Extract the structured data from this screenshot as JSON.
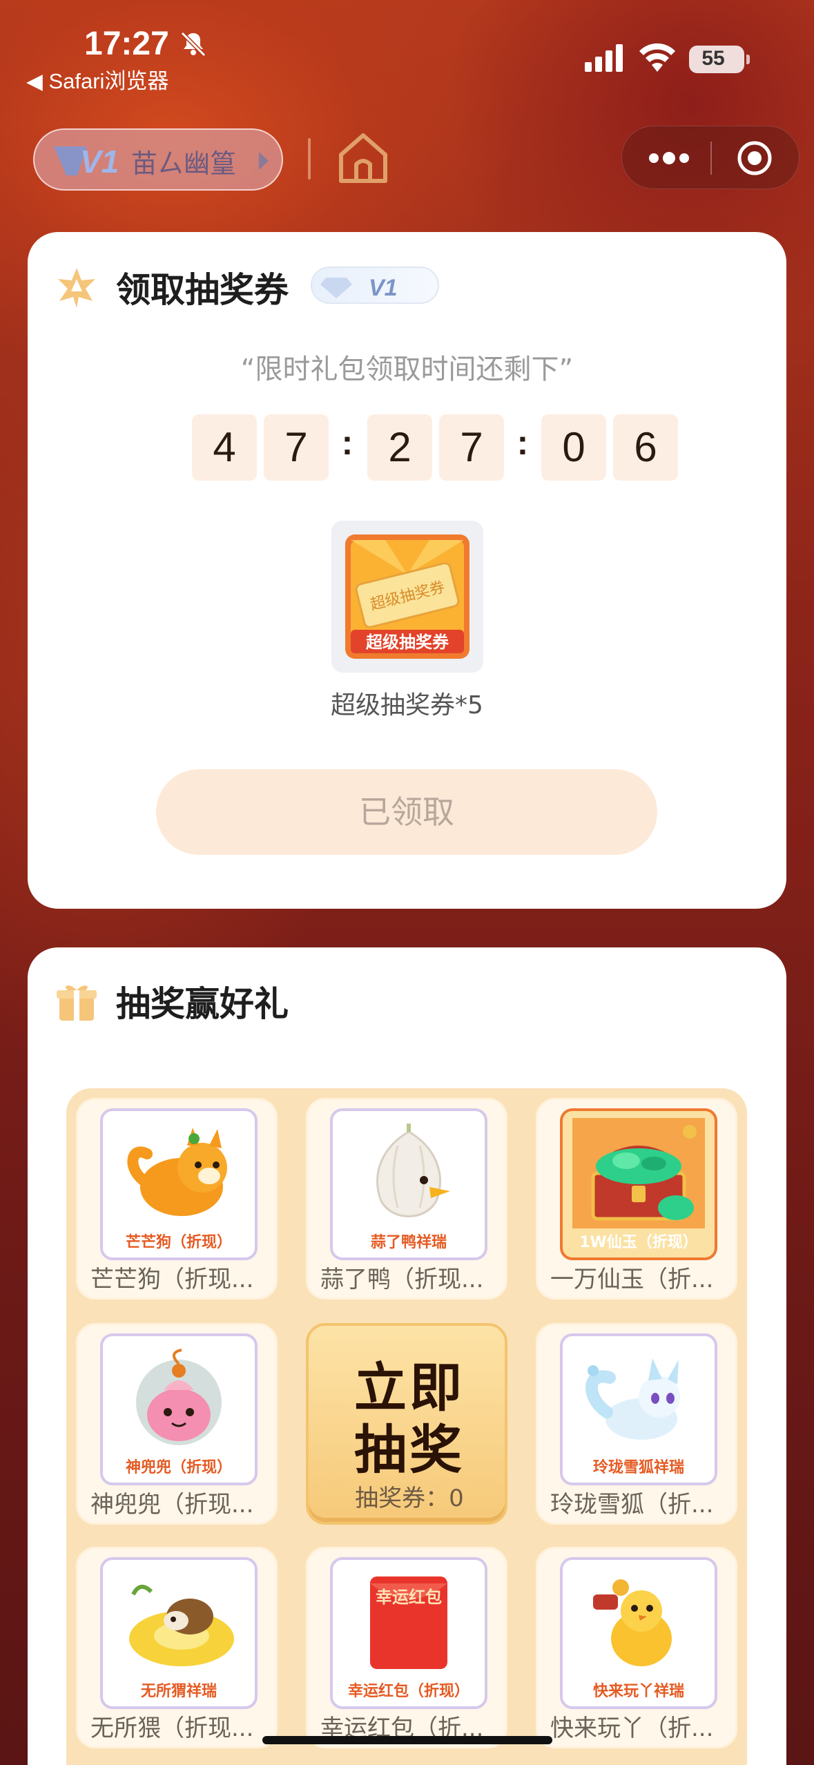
{
  "status_bar": {
    "time": "17:27",
    "back_app": "◀ Safari浏览器",
    "battery": "55"
  },
  "nav": {
    "vip_level": "V1",
    "username": "苗ㄙ幽篁",
    "menu_icon": "more-dots-icon",
    "close_icon": "target-icon"
  },
  "claim_card": {
    "title": "领取抽奖券",
    "badge": "V1",
    "subtitle": "“限时礼包领取时间还剩下”",
    "countdown": {
      "h1": "4",
      "h2": "7",
      "sep1": ":",
      "m1": "2",
      "m2": "7",
      "sep2": ":",
      "s1": "0",
      "s2": "6"
    },
    "reward_art_text": "超级抽奖券",
    "reward_label": "超级抽奖券*5",
    "button_label": "已领取"
  },
  "lottery_card": {
    "title": "抽奖赢好礼",
    "draw_button": {
      "line1": "立即",
      "line2": "抽奖",
      "ticket_text": "抽奖券：0"
    },
    "prizes": [
      {
        "caption": "芒芒狗（折现）",
        "name": "芒芒狗（折现...",
        "icon": "orange-dog-icon"
      },
      {
        "caption": "蒜了鸭祥瑞",
        "name": "蒜了鸭（折现...",
        "icon": "garlic-duck-icon"
      },
      {
        "caption": "1W仙玉（折现）",
        "name": "一万仙玉（折...",
        "icon": "jade-chest-icon"
      },
      {
        "caption": "神兜兜（折现）",
        "name": "神兜兜（折现...",
        "icon": "pink-pouch-icon"
      },
      {
        "caption": "玲珑雪狐祥瑞",
        "name": "玲珑雪狐（折...",
        "icon": "snow-fox-icon"
      },
      {
        "caption": "无所猬祥瑞",
        "name": "无所猥（折现...",
        "icon": "hedgehog-float-icon"
      },
      {
        "caption": "幸运红包（折现）",
        "name": "幸运红包（折...",
        "icon": "red-envelope-icon",
        "envelope_text": "幸运红包"
      },
      {
        "caption": "快来玩丫祥瑞",
        "name": "快来玩丫（折...",
        "icon": "chick-icon"
      }
    ]
  },
  "colors": {
    "accent": "#e55a22",
    "button_disabled_bg": "#fde9d8",
    "countdown_bg": "#fdeee3",
    "grid_bg": "#fbe1b8"
  }
}
